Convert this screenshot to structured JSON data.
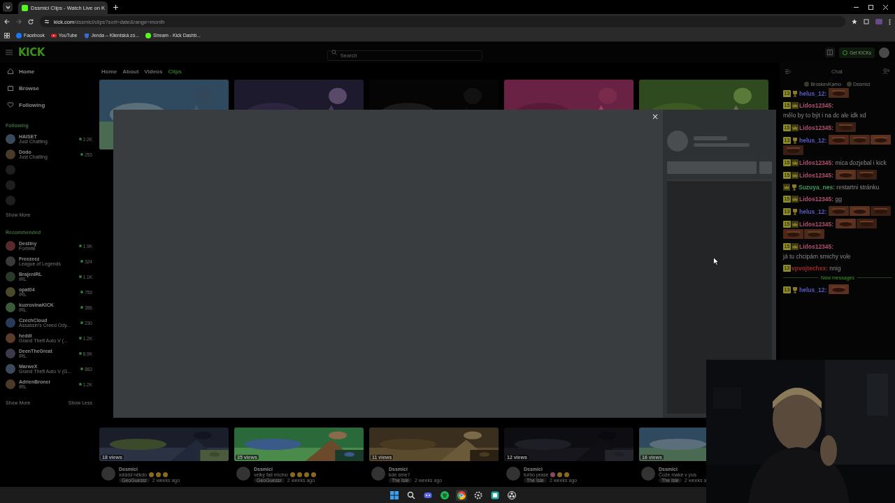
{
  "browser": {
    "tab": {
      "title": "Dssmici Clips - Watch Live on K",
      "selected": true
    },
    "url": {
      "host": "kick.com",
      "path": "/dssmici/clips?sort=date&range=month"
    },
    "bookmarks": [
      {
        "label": "Facebook",
        "kind": "facebook"
      },
      {
        "label": "YouTube",
        "kind": "youtube"
      },
      {
        "label": "Jenda – Klientská zó...",
        "kind": "shield"
      },
      {
        "label": "Stream - Kick Dashb...",
        "kind": "kick"
      }
    ]
  },
  "header": {
    "logo": "KICK",
    "search": {
      "placeholder": "Search"
    },
    "get_kicks": "Get KICKs"
  },
  "sidebar": {
    "nav": [
      {
        "label": "Home",
        "kind": "home"
      },
      {
        "label": "Browse",
        "kind": "browse"
      },
      {
        "label": "Following",
        "kind": "heart"
      }
    ],
    "following": {
      "title": "Following",
      "channels": [
        {
          "kind": "live",
          "name": "HAISET",
          "category": "Just Chatting",
          "viewers": "2.2K"
        },
        {
          "kind": "live",
          "name": "Dodo",
          "category": "Just Chatting",
          "viewers": "253"
        },
        {
          "kind": "offline"
        },
        {
          "kind": "offline"
        },
        {
          "kind": "offline"
        }
      ],
      "show_more": "Show More"
    },
    "recommended": {
      "title": "Recommended",
      "channels": [
        {
          "kind": "live",
          "name": "Destiny",
          "category": "Fortnite",
          "viewers": "1.9K"
        },
        {
          "kind": "live",
          "name": "Freezecz",
          "category": "League of Legends",
          "viewers": "324"
        },
        {
          "kind": "live",
          "name": "BrajenIRL",
          "category": "IRL",
          "viewers": "1.1K"
        },
        {
          "kind": "live",
          "name": "opat04",
          "category": "IRL",
          "viewers": "759"
        },
        {
          "kind": "live",
          "name": "kuzrovinaKICK",
          "category": "IRL",
          "viewers": "356"
        },
        {
          "kind": "live",
          "name": "CzechCloud",
          "category": "Assassin's Creed Ody...",
          "viewers": "230"
        },
        {
          "kind": "live",
          "name": "heddi",
          "category": "Grand Theft Auto V (...",
          "viewers": "1.2K"
        },
        {
          "kind": "live",
          "name": "DeenTheGreat",
          "category": "IRL",
          "viewers": "8.9K"
        },
        {
          "kind": "live",
          "name": "MarweX",
          "category": "Grand Theft Auto V (G...",
          "viewers": "883"
        },
        {
          "kind": "live",
          "name": "AdrienBroner",
          "category": "IRL",
          "viewers": "1.2K"
        }
      ],
      "show_more": "Show More",
      "show_less": "Show Less"
    }
  },
  "channel_tabs": [
    {
      "label": "Home",
      "selected": false
    },
    {
      "label": "About",
      "selected": false
    },
    {
      "label": "Videos",
      "selected": false
    },
    {
      "label": "Clips",
      "selected": true
    }
  ],
  "clips": [
    {
      "kind": "picture",
      "views": "18 views",
      "author": "Dssmici",
      "title": "xdddd někdo",
      "emojis": [
        {
          "kind": "laugh"
        },
        {
          "kind": "laugh"
        },
        {
          "kind": "laugh"
        }
      ],
      "tag": "GeoGuessr",
      "age": "2 weeks ago"
    },
    {
      "kind": "picture",
      "views": "35 views",
      "author": "Dssmici",
      "title": "velký fail micino",
      "emojis": [
        {
          "kind": "laugh"
        },
        {
          "kind": "laugh"
        },
        {
          "kind": "laugh"
        },
        {
          "kind": "laugh"
        }
      ],
      "tag": "GeoGuessr",
      "age": "2 weeks ago"
    },
    {
      "kind": "picture",
      "views": "11 views",
      "author": "Dssmici",
      "title": "kde sme?",
      "tag": "The Isle",
      "age": "2 weeks ago"
    },
    {
      "kind": "picture",
      "views": "12 views",
      "author": "Dssmici",
      "title": "turbo prase",
      "emojis": [
        {
          "kind": "pig"
        },
        {
          "kind": "laugh"
        },
        {
          "kind": "laugh"
        }
      ],
      "tag": "The Isle",
      "age": "2 weeks ago"
    },
    {
      "kind": "picture",
      "views": "16 views",
      "author": "Dssmici",
      "title": "Čože make v pus",
      "tag": "The Isle",
      "age": "2 weeks a"
    }
  ],
  "modal": {
    "close": "×"
  },
  "chat": {
    "title": "Chat",
    "pinned": [
      {
        "name": "BroskevKamo"
      },
      {
        "name": "Dssmici"
      }
    ],
    "messages": [
      {
        "user": "helus_12:",
        "color": "#5a5ac0",
        "badges": [
          {
            "kind": "sub",
            "label": "13"
          },
          {
            "kind": "trophy"
          }
        ],
        "emotes": [
          {
            "kind": "emote"
          }
        ]
      },
      {
        "user": "Lidos12345:",
        "color": "#b0506e",
        "badges": [
          {
            "kind": "sub",
            "label": "15"
          },
          {
            "kind": "crown"
          }
        ],
        "text": "mělo by to být i na dc ale idk xd"
      },
      {
        "user": "Lidos12345:",
        "color": "#b0506e",
        "badges": [
          {
            "kind": "sub",
            "label": "15"
          },
          {
            "kind": "crown"
          }
        ],
        "emotes": [
          {
            "kind": "emote"
          }
        ]
      },
      {
        "user": "helus_12:",
        "color": "#5a5ac0",
        "badges": [
          {
            "kind": "sub",
            "label": "13"
          },
          {
            "kind": "trophy"
          }
        ],
        "emotes": [
          {
            "kind": "emote"
          },
          {
            "kind": "emote"
          },
          {
            "kind": "emote"
          },
          {
            "kind": "emote"
          }
        ]
      },
      {
        "user": "Lidos12345:",
        "color": "#b0506e",
        "badges": [
          {
            "kind": "sub",
            "label": "15"
          },
          {
            "kind": "crown"
          }
        ],
        "text": "mica dozjebal i kick"
      },
      {
        "user": "Lidos12345:",
        "color": "#b0506e",
        "badges": [
          {
            "kind": "sub",
            "label": "15"
          },
          {
            "kind": "crown"
          }
        ],
        "emotes": [
          {
            "kind": "emote"
          },
          {
            "kind": "emote"
          }
        ]
      },
      {
        "user": "Suzuya_nes:",
        "color": "#3a9a5c",
        "badges": [
          {
            "kind": "crown"
          },
          {
            "kind": "trophy"
          }
        ],
        "text": "restartni stránku"
      },
      {
        "user": "Lidos12345:",
        "color": "#b0506e",
        "badges": [
          {
            "kind": "sub",
            "label": "15"
          },
          {
            "kind": "crown"
          }
        ],
        "text": "gg"
      },
      {
        "user": "helus_12:",
        "color": "#5a5ac0",
        "badges": [
          {
            "kind": "sub",
            "label": "13"
          },
          {
            "kind": "trophy"
          }
        ],
        "emotes": [
          {
            "kind": "emote"
          },
          {
            "kind": "emote"
          },
          {
            "kind": "emote"
          }
        ]
      },
      {
        "user": "Lidos12345:",
        "color": "#b0506e",
        "badges": [
          {
            "kind": "sub",
            "label": "15"
          },
          {
            "kind": "crown"
          }
        ],
        "emotes": [
          {
            "kind": "emote"
          },
          {
            "kind": "emote"
          },
          {
            "kind": "emote"
          },
          {
            "kind": "emote"
          }
        ]
      },
      {
        "user": "Lidos12345:",
        "color": "#b0506e",
        "badges": [
          {
            "kind": "sub",
            "label": "15"
          },
          {
            "kind": "crown"
          }
        ],
        "text": "já tu chcipám smichy vole"
      },
      {
        "user": "vpvojtechxx:",
        "color": "#a02828",
        "badges": [
          {
            "kind": "sub",
            "label": "13"
          }
        ],
        "text": "nnig"
      },
      {
        "kind": "divider",
        "label": "New messages"
      },
      {
        "user": "helus_12:",
        "color": "#5a5ac0",
        "badges": [
          {
            "kind": "sub",
            "label": "13"
          },
          {
            "kind": "trophy"
          }
        ],
        "emotes": [
          {
            "kind": "emote"
          }
        ]
      }
    ]
  },
  "taskbar": [
    {
      "kind": "windows"
    },
    {
      "kind": "search"
    },
    {
      "kind": "discord"
    },
    {
      "kind": "spotify"
    },
    {
      "kind": "chrome",
      "selected": true
    },
    {
      "kind": "gear"
    },
    {
      "kind": "app"
    },
    {
      "kind": "obs"
    }
  ]
}
